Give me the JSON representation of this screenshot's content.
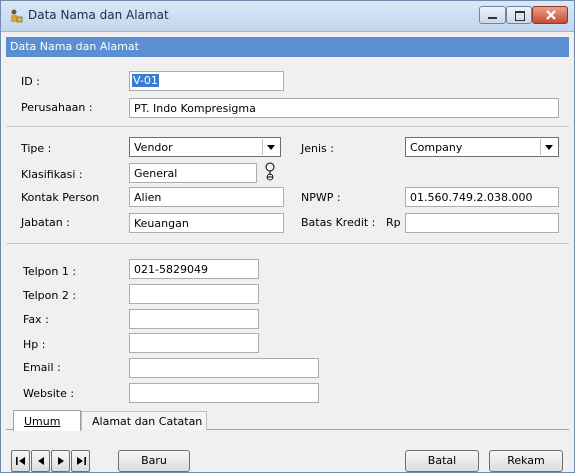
{
  "window": {
    "title": "Data Nama dan Alamat",
    "icon": "user-lock-icon"
  },
  "header_band": "Data Nama dan Alamat",
  "fields": {
    "id": {
      "label": "ID :",
      "value": "V-01"
    },
    "perusahaan": {
      "label": "Perusahaan :",
      "value": "PT. Indo Kompresigma"
    },
    "tipe": {
      "label": "Tipe :",
      "value": "Vendor"
    },
    "jenis": {
      "label": "Jenis :",
      "value": "Company"
    },
    "klasifikasi": {
      "label": "Klasifikasi :",
      "value": "General"
    },
    "kontak_person": {
      "label": "Kontak Person",
      "value": "Alien"
    },
    "npwp": {
      "label": "NPWP :",
      "value": "01.560.749.2.038.000"
    },
    "jabatan": {
      "label": "Jabatan :",
      "value": "Keuangan"
    },
    "batas_kredit": {
      "label": "Batas Kredit :",
      "currency": "Rp",
      "value": ""
    },
    "telpon1": {
      "label": "Telpon 1 :",
      "value": "021-5829049"
    },
    "telpon2": {
      "label": "Telpon 2 :",
      "value": ""
    },
    "fax": {
      "label": "Fax :",
      "value": ""
    },
    "hp": {
      "label": "Hp :",
      "value": ""
    },
    "email": {
      "label": "Email :",
      "value": ""
    },
    "website": {
      "label": "Website :",
      "value": ""
    }
  },
  "tabs": [
    {
      "label": "Umum",
      "active": true
    },
    {
      "label": "Alamat dan Catatan",
      "active": false
    }
  ],
  "buttons": {
    "baru": "Baru",
    "batal": "Batal",
    "rekam": "Rekam"
  },
  "nav_icons": [
    "first-record-icon",
    "prev-record-icon",
    "next-record-icon",
    "last-record-icon"
  ],
  "colors": {
    "header_band": "#5c8fd1",
    "selection": "#3a7bd5",
    "close_button": "#c84a32"
  }
}
